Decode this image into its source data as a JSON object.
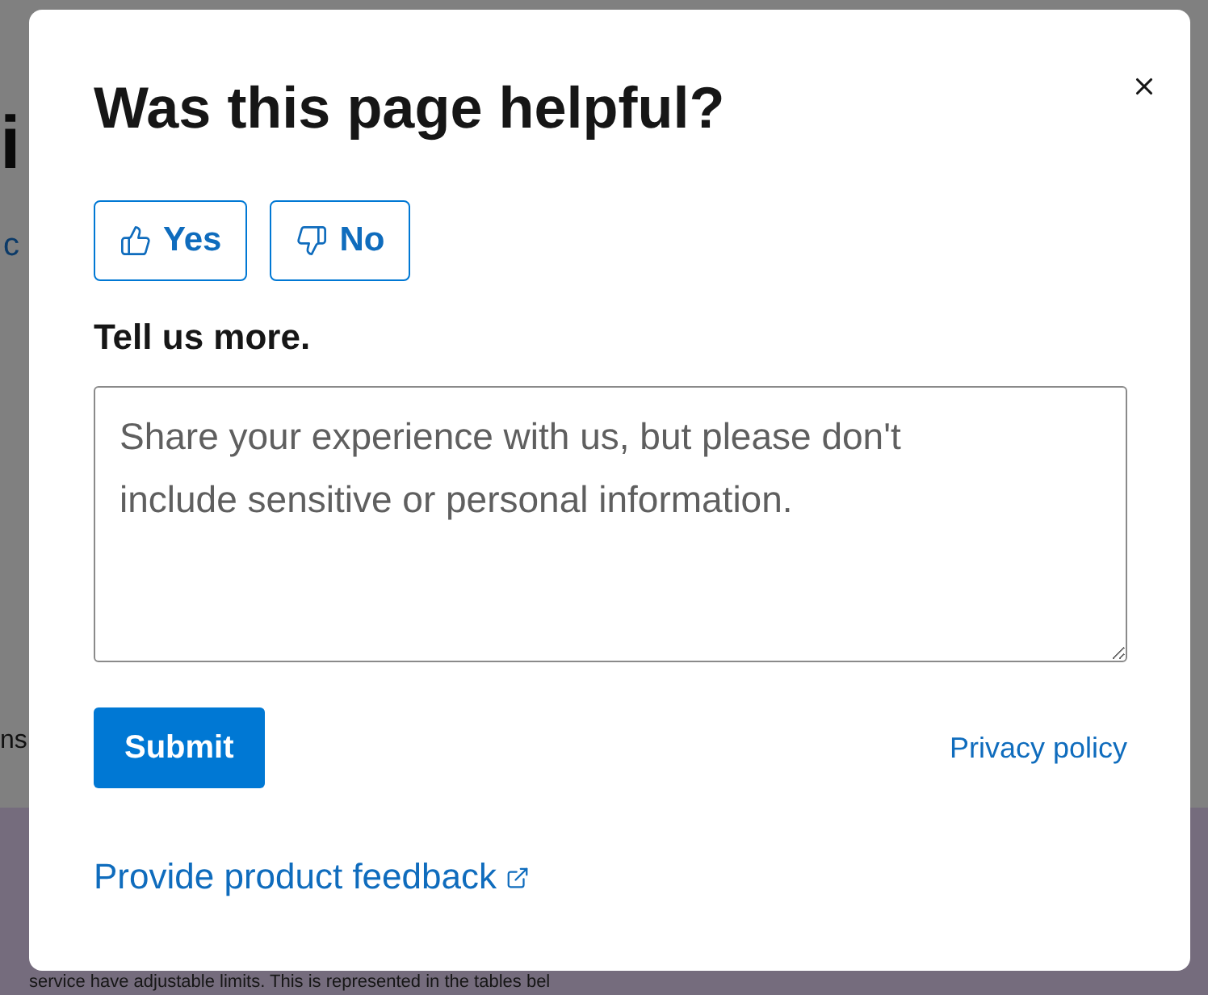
{
  "background_page": {
    "heading_fragment": "i",
    "link_fragment": "c",
    "text_fragment": "ns",
    "bottom_text": "service have adjustable limits. This is represented in the tables bel"
  },
  "dialog": {
    "title": "Was this page helpful?",
    "rating_buttons": [
      {
        "kind": "up",
        "label": "Yes",
        "selected": false
      },
      {
        "kind": "down",
        "label": "No",
        "selected": false
      }
    ],
    "prompt": "Tell us more.",
    "comment_field": {
      "placeholder": "Share your experience with us, but please don't include sensitive or personal information."
    },
    "submit_button": "Submit",
    "privacy_link": "Privacy policy",
    "feedback_link": {
      "label": "Provide product feedback",
      "external": true
    }
  }
}
